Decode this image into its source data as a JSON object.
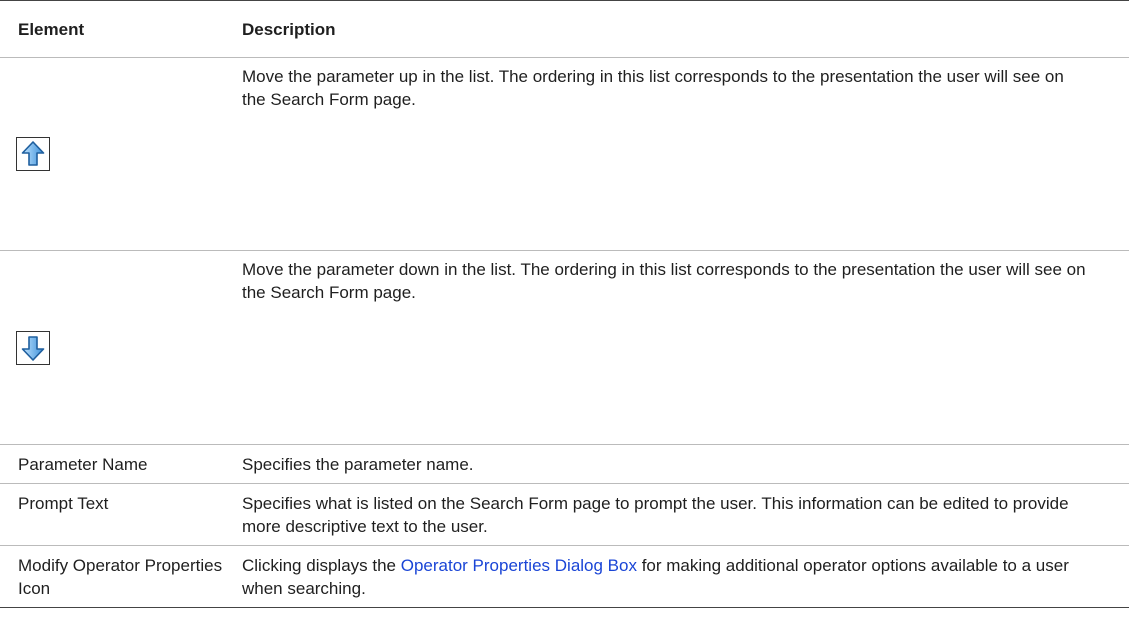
{
  "table": {
    "headers": {
      "element": "Element",
      "description": "Description"
    },
    "rows": [
      {
        "icon": "move-up-arrow-icon",
        "description": "Move the parameter up in the list. The ordering in this list corresponds to the presentation the user will see on the Search Form page."
      },
      {
        "icon": "move-down-arrow-icon",
        "description": "Move the parameter down in the list. The ordering in this list corresponds to the presentation the user will see on the Search Form page."
      },
      {
        "element": "Parameter Name",
        "description": "Specifies the parameter name."
      },
      {
        "element": "Prompt Text",
        "description": "Specifies what is listed on the Search Form page to prompt the user. This information can be edited to provide more descriptive text to the user."
      },
      {
        "element": "Modify Operator Properties Icon",
        "description_before": "Clicking displays the ",
        "description_link": "Operator Properties Dialog Box",
        "description_after": " for making additional operator options available to a user when searching."
      }
    ]
  },
  "colors": {
    "arrow_fill": "#5aa9e8",
    "arrow_stroke": "#1f5f9e",
    "link": "#1a45d6"
  }
}
